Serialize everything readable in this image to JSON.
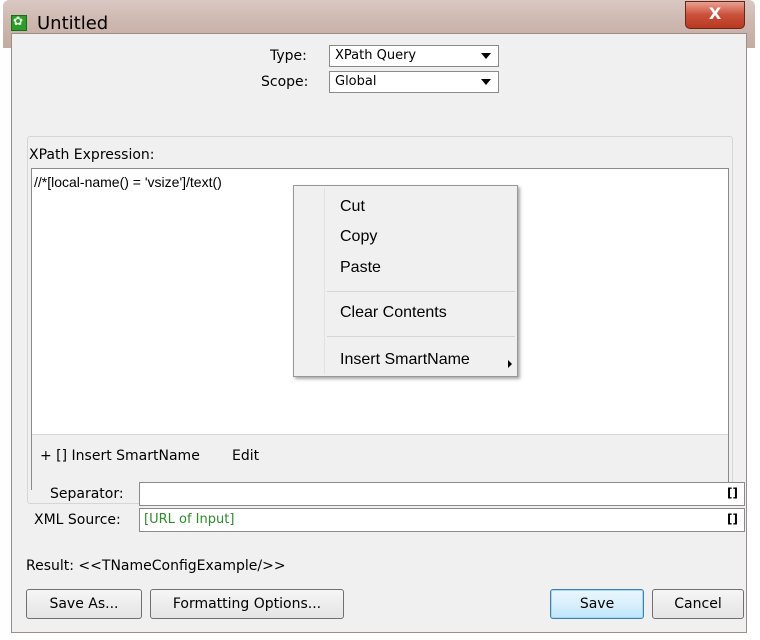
{
  "window": {
    "title": "Untitled",
    "close_label": "X"
  },
  "type": {
    "label": "Type:",
    "value": "XPath Query"
  },
  "scope": {
    "label": "Scope:",
    "value": "Global"
  },
  "expression": {
    "label": "XPath Expression:",
    "value": "//*[local-name() = 'vsize']/text()",
    "insert_smartname": "+ [] Insert SmartName",
    "edit": "Edit"
  },
  "context_menu": {
    "items": [
      "Cut",
      "Copy",
      "Paste",
      "Clear Contents",
      "Insert SmartName"
    ]
  },
  "separator": {
    "label": "Separator:",
    "value": "",
    "bracket": "[]"
  },
  "xml_source": {
    "label": "XML Source:",
    "value": "[URL of Input]",
    "bracket": "[]"
  },
  "result": "Result: <<TNameConfigExample/>>",
  "buttons": {
    "save_as": "Save As...",
    "formatting": "Formatting Options...",
    "save": "Save",
    "cancel": "Cancel"
  }
}
